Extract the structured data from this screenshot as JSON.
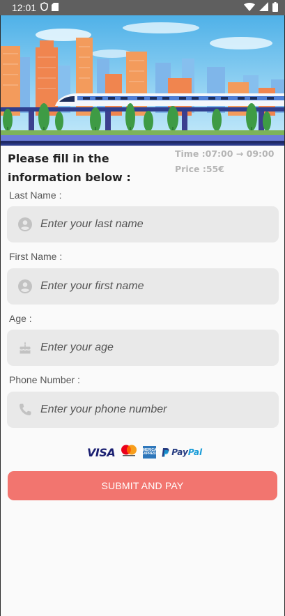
{
  "status_bar": {
    "time": "12:01"
  },
  "header": {
    "title": "Please fill in the information below :"
  },
  "trip": {
    "time": "Time :07:00 → 09:00",
    "price": "Price :55€"
  },
  "form": {
    "last_name": {
      "label": "Last Name :",
      "placeholder": "Enter your last name",
      "icon": "person-icon"
    },
    "first_name": {
      "label": "First Name :",
      "placeholder": "Enter your first name",
      "icon": "person-icon"
    },
    "age": {
      "label": "Age :",
      "placeholder": "Enter your age",
      "icon": "cake-icon"
    },
    "phone": {
      "label": "Phone Number :",
      "placeholder": "Enter your phone number",
      "icon": "phone-icon"
    }
  },
  "payment": {
    "visa": "VISA",
    "amex": "AMERICAN EXPRESS",
    "paypal_pay": "Pay",
    "paypal_pal": "Pal"
  },
  "submit_label": "SUBMIT AND PAY",
  "colors": {
    "accent": "#f2756f",
    "field_bg": "#e9e9e9",
    "status_bar": "#5f5f5f"
  }
}
